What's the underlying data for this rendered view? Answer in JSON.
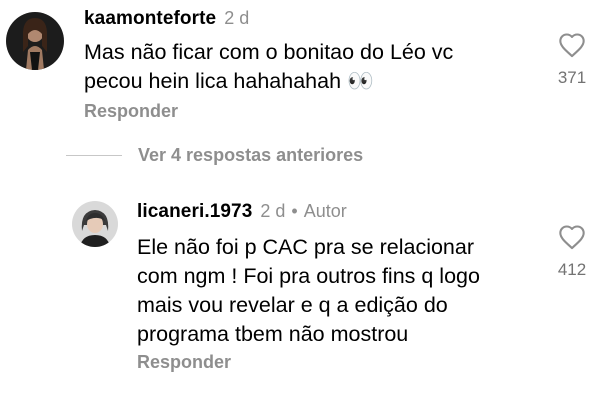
{
  "comments": [
    {
      "username": "kaamonteforte",
      "time": "2 d",
      "text": "Mas não ficar com o bonitao do Léo vc\npecou hein lica hahahahah 👀",
      "reply_label": "Responder",
      "likes": "371",
      "avatar_icon": "profile-photo-woman-dark-hair"
    },
    {
      "username": "licaneri.1973",
      "time": "2 d",
      "separator": "•",
      "author_badge": "Autor",
      "text": "Ele não foi p CAC pra se relacionar\ncom ngm ! Foi pra outros fins q logo\nmais vou revelar e q a edição do\nprograma tbem não mostrou",
      "reply_label": "Responder",
      "likes": "412",
      "avatar_icon": "profile-photo-woman-blonde"
    }
  ],
  "view_replies_label": "Ver 4 respostas anteriores",
  "icons": {
    "like": "heart-outline-icon"
  },
  "colors": {
    "text": "#000000",
    "muted": "#8e8e8e",
    "background": "#ffffff"
  }
}
